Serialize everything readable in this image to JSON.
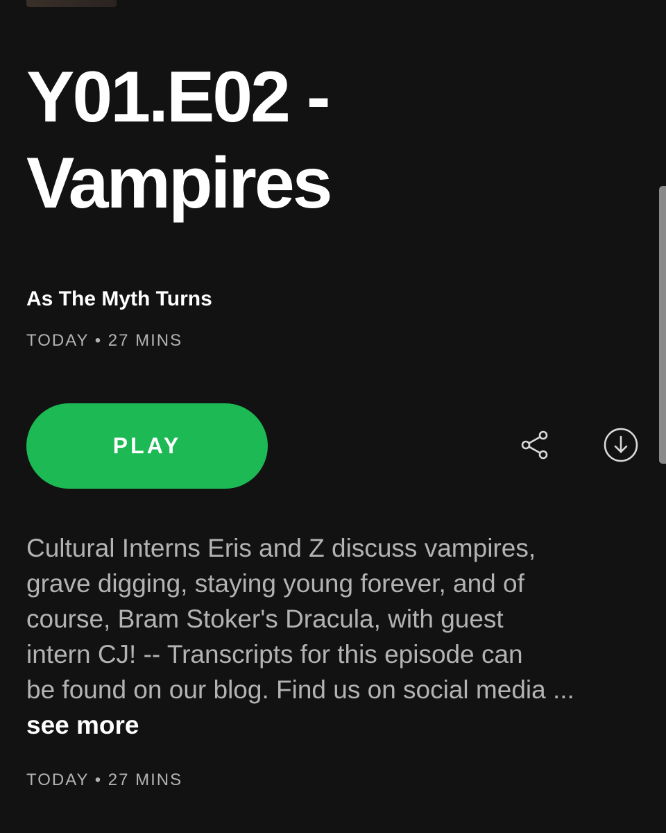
{
  "episode": {
    "title_line1": "Y01.E02 -",
    "title_line2": "Vampires",
    "show_name": "As The Myth Turns",
    "meta": "TODAY • 27 MINS"
  },
  "actions": {
    "play_label": "PLAY",
    "share_icon": "share-icon",
    "download_icon": "download-circle-icon"
  },
  "description": {
    "lines": [
      "Cultural Interns Eris and Z discuss vampires,",
      "grave digging, staying young forever, and of",
      "course, Bram Stoker's Dracula, with guest",
      "intern CJ! -- Transcripts for this episode can",
      "be found on our blog. Find us on social media ..."
    ],
    "see_more_label": "see more"
  },
  "footer": {
    "meta": "TODAY • 27 MINS"
  },
  "colors": {
    "background": "#121212",
    "accent": "#1db954",
    "secondary_text": "#b3b3b3"
  }
}
